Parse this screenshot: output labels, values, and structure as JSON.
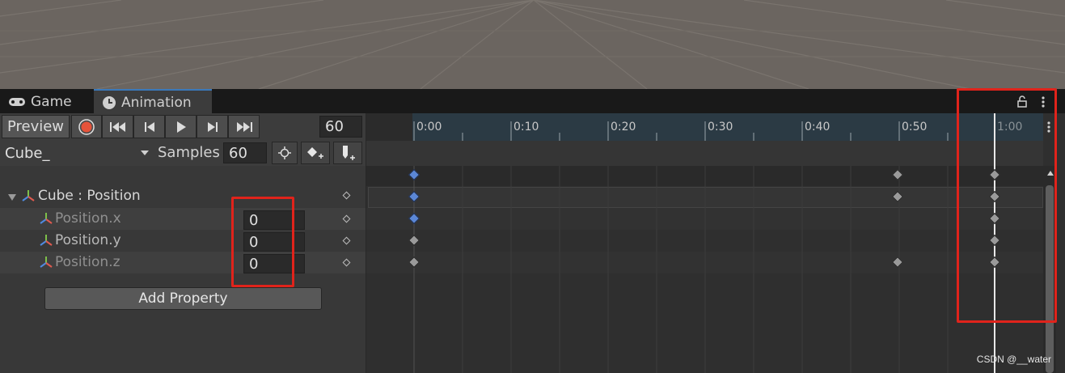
{
  "tabs": [
    {
      "label": "Game",
      "icon": "gamepad-icon"
    },
    {
      "label": "Animation",
      "icon": "clock-icon"
    }
  ],
  "toolbar": {
    "preview_label": "Preview",
    "frame_value": "60",
    "clip_name": "Cube_",
    "samples_label": "Samples",
    "samples_value": "60"
  },
  "properties": {
    "group_label": "Cube : Position",
    "items": [
      {
        "label": "Position.x",
        "value": "0"
      },
      {
        "label": "Position.y",
        "value": "0"
      },
      {
        "label": "Position.z",
        "value": "0"
      }
    ],
    "add_button": "Add Property"
  },
  "timeline": {
    "ticks": [
      "0:00",
      "0:10",
      "0:20",
      "0:30",
      "0:40",
      "0:50",
      "1:00"
    ],
    "playhead_time": "1:00"
  },
  "colors": {
    "highlight": "#e0231b",
    "selected_key": "#5b87d6",
    "ruler": "#2b3a44"
  },
  "watermark": "CSDN @__water"
}
